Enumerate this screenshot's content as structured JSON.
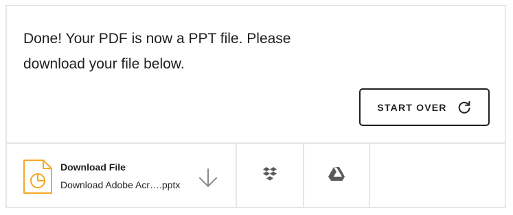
{
  "message": {
    "text": "Done! Your PDF is now a PPT file. Please download your file below."
  },
  "start_over": {
    "label": "START OVER",
    "icon": "refresh-icon"
  },
  "download": {
    "title": "Download File",
    "file_name": "Download Adobe Acr….pptx",
    "file_icon": "ppt-file-icon",
    "action_icon": "download-arrow-icon",
    "accent_color": "#f5a623"
  },
  "share": {
    "dropbox_icon": "dropbox-icon",
    "drive_icon": "google-drive-icon",
    "icon_color": "#5a5a5a"
  },
  "colors": {
    "border": "#e6e6e6",
    "text": "#1f1f1f"
  }
}
